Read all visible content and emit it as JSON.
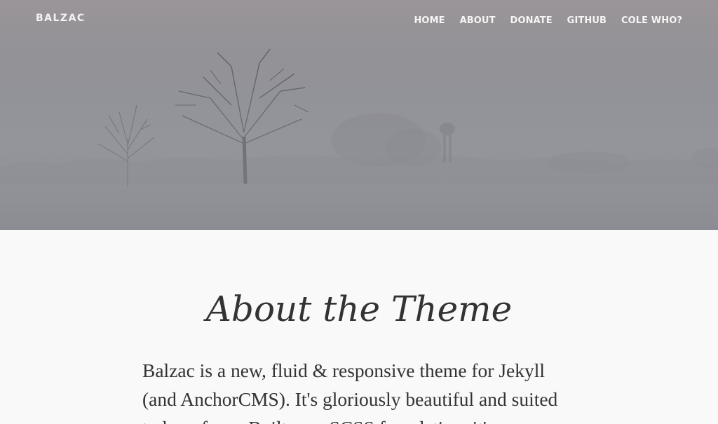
{
  "header": {
    "brand": "BALZAC",
    "nav": [
      {
        "label": "HOME"
      },
      {
        "label": "ABOUT"
      },
      {
        "label": "DONATE"
      },
      {
        "label": "GITHUB"
      },
      {
        "label": "COLE WHO?"
      }
    ]
  },
  "hero": {
    "image": "misty-field-with-bare-trees"
  },
  "main": {
    "title": "About the Theme",
    "intro": "Balzac is a new, fluid & responsive theme for Jekyll (and AnchorCMS). It's gloriously beautiful and suited to long form. Built on a SCSS foundation, it's"
  },
  "colors": {
    "hero_tint": "#8c8e95",
    "page_background": "#f9f9f9",
    "text": "#333333",
    "nav_text": "#f6f4f4"
  }
}
